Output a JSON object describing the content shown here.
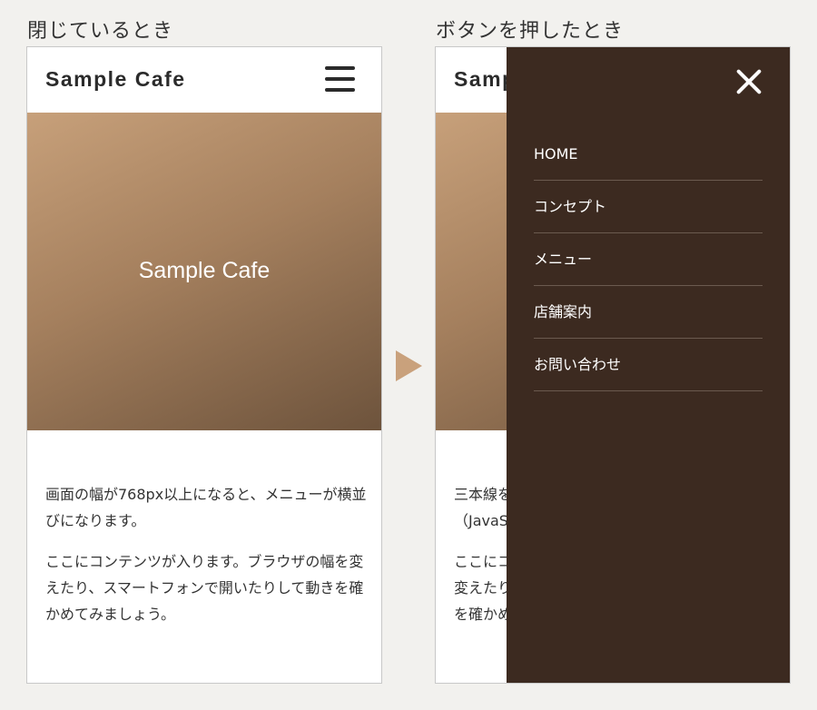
{
  "captions": {
    "closed": "閉じているとき",
    "opened": "ボタンを押したとき"
  },
  "site": {
    "logo": "Sample Cafe",
    "hero_title": "Sample Cafe"
  },
  "closed_view": {
    "paragraphs": [
      "画面の幅が768px以上になると、メニューが横並びになります。",
      "ここにコンテンツが入ります。ブラウザの幅を変えたり、スマートフォンで開いたりして動きを確かめてみましょう。"
    ]
  },
  "open_view": {
    "logo_partial": "Samp",
    "paragraphs_partial": [
      "三本線を",
      "（JavaS",
      "ここにコ",
      "変えたり",
      "を確かめ"
    ],
    "menu": [
      {
        "label": "HOME"
      },
      {
        "label": "コンセプト"
      },
      {
        "label": "メニュー"
      },
      {
        "label": "店舗案内"
      },
      {
        "label": "お問い合わせ"
      }
    ]
  },
  "icons": {
    "menu_open": "hamburger-icon",
    "menu_close": "close-icon",
    "transition": "arrow-right-icon"
  },
  "colors": {
    "drawer_bg": "#3c2a20",
    "arrow": "#c9a17c",
    "hero_start": "#c7a07a",
    "hero_end": "#6d533c"
  }
}
